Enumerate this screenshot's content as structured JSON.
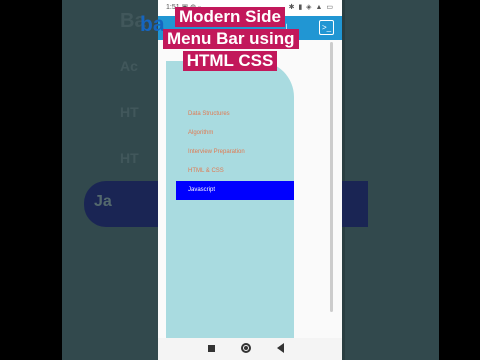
{
  "background": {
    "left_ghost_texts": [
      "Ba",
      "Ac",
      "HT",
      "HT"
    ],
    "left_band_label": "Ja",
    "colors": {
      "panel": "#3f5a5e",
      "band": "#0a0a6e"
    }
  },
  "statusbar": {
    "time": "1:51 ▣ ◍ ▫",
    "icons": "✱ ▮ ◈ ▲ ▭"
  },
  "appbar": {
    "text": "",
    "download_icon": "download-icon",
    "terminal_icon": "terminal-icon",
    "color": "#2196d3"
  },
  "logo": {
    "text": "ba"
  },
  "banner": {
    "lines": [
      "Modern Side",
      "Menu Bar using",
      "HTML CSS"
    ],
    "color": "#c2185b"
  },
  "sidebar": {
    "title": "",
    "items": [
      {
        "label": "Data Structures",
        "active": false
      },
      {
        "label": "Algorithm",
        "active": false
      },
      {
        "label": "Interview Preparation",
        "active": false
      },
      {
        "label": "HTML & CSS",
        "active": false
      },
      {
        "label": "Javascript",
        "active": true
      }
    ],
    "colors": {
      "bg": "#a9dbe0",
      "text": "#e07a52",
      "active_bg": "#0000ff",
      "active_text": "#ffffff"
    }
  },
  "navbar": {
    "square_icon": "recent-apps-icon",
    "circle_icon": "home-icon",
    "back_icon": "back-icon"
  }
}
